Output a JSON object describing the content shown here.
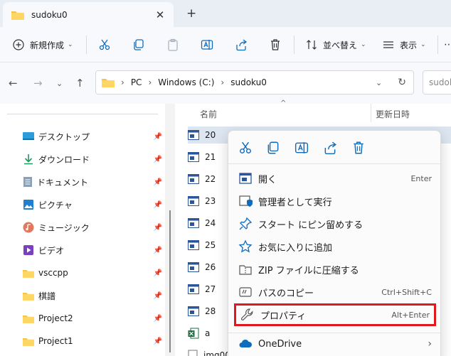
{
  "window": {
    "tab_title": "sudoku0",
    "tab_close": "✕",
    "new_tab": "+"
  },
  "toolbar": {
    "new_label": "新規作成",
    "sort_label": "並べ替え",
    "view_label": "表示"
  },
  "address": {
    "crumbs": [
      "PC",
      "Windows (C:)",
      "sudoku0"
    ],
    "search_placeholder": "sudok"
  },
  "sidebar": {
    "items": [
      {
        "label": "デスクトップ",
        "icon": "desktop-icon",
        "pinned": true
      },
      {
        "label": "ダウンロード",
        "icon": "download-icon",
        "pinned": true
      },
      {
        "label": "ドキュメント",
        "icon": "document-icon",
        "pinned": true
      },
      {
        "label": "ピクチャ",
        "icon": "picture-icon",
        "pinned": true
      },
      {
        "label": "ミュージック",
        "icon": "music-icon",
        "pinned": true
      },
      {
        "label": "ビデオ",
        "icon": "video-icon",
        "pinned": true
      },
      {
        "label": "vsccpp",
        "icon": "folder-icon",
        "pinned": true
      },
      {
        "label": "棋譜",
        "icon": "folder-icon",
        "pinned": true
      },
      {
        "label": "Project2",
        "icon": "folder-icon",
        "pinned": true
      },
      {
        "label": "Project1",
        "icon": "folder-icon",
        "pinned": true
      }
    ]
  },
  "filelist": {
    "col_name": "名前",
    "col_date": "更新日時",
    "rows": [
      {
        "name": "20",
        "selected": true
      },
      {
        "name": "21"
      },
      {
        "name": "22"
      },
      {
        "name": "23"
      },
      {
        "name": "24"
      },
      {
        "name": "25"
      },
      {
        "name": "26"
      },
      {
        "name": "27"
      },
      {
        "name": "28"
      },
      {
        "name": "a"
      },
      {
        "name": "img00"
      }
    ]
  },
  "context_menu": {
    "items": [
      {
        "label": "開く",
        "shortcut": "Enter"
      },
      {
        "label": "管理者として実行",
        "shortcut": ""
      },
      {
        "label": "スタート にピン留めする",
        "shortcut": ""
      },
      {
        "label": "お気に入りに追加",
        "shortcut": ""
      },
      {
        "label": "ZIP ファイルに圧縮する",
        "shortcut": ""
      },
      {
        "label": "パスのコピー",
        "shortcut": "Ctrl+Shift+C"
      },
      {
        "label": "プロパティ",
        "shortcut": "Alt+Enter",
        "highlighted": true
      },
      {
        "label": "OneDrive",
        "shortcut": "›"
      }
    ]
  },
  "colors": {
    "accent": "#0f6cbd",
    "highlight_border": "#e0191e",
    "folder": "#f5c242"
  }
}
